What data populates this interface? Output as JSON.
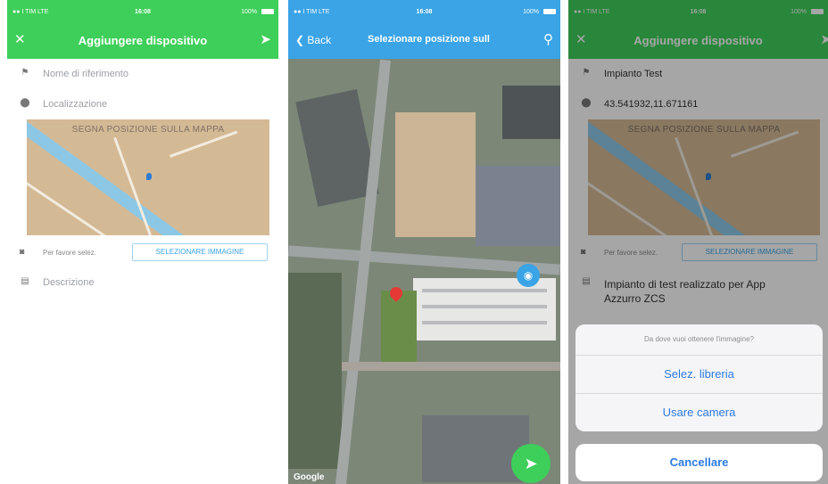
{
  "screen1": {
    "status": {
      "carrier": "●● I TIM LTE",
      "time": "16:08",
      "battery": "100%"
    },
    "nav": {
      "title": "Aggiungere dispositivo",
      "left_icon": "close-icon",
      "right_icon": "send-icon"
    },
    "name_placeholder": "Nome di riferimento",
    "location_placeholder": "Localizzazione",
    "map_caption": "SEGNA POSIZIONE SULLA MAPPA",
    "image_label": "Per favore selez.",
    "image_button": "SELEZIONARE IMMAGINE",
    "description_placeholder": "Descrizione"
  },
  "screen2": {
    "status": {
      "carrier": "●● I TIM LTE",
      "time": "16:08",
      "battery": "100%"
    },
    "nav": {
      "back": "Back",
      "title": "Selezionare posizione sull"
    },
    "google": "Google"
  },
  "screen3": {
    "status": {
      "carrier": "●● I TIM LTE",
      "time": "16:08",
      "battery": "100%"
    },
    "nav": {
      "title": "Aggiungere dispositivo"
    },
    "name_value": "Impianto Test",
    "location_value": "43.541932,11.671161",
    "map_caption": "SEGNA POSIZIONE SULLA MAPPA",
    "image_label": "Per favore selez.",
    "image_button": "SELEZIONARE IMMAGINE",
    "description_value": "Impianto di test realizzato per App Azzurro ZCS",
    "sheet": {
      "question": "Da dove vuoi ottenere l'immagine?",
      "library": "Selez. libreria",
      "camera": "Usare camera",
      "cancel": "Cancellare"
    }
  },
  "colors": {
    "green": "#3ecf5a",
    "blue": "#3aa4e6",
    "ios_blue": "#2d7be0",
    "pin_red": "#e53935"
  }
}
